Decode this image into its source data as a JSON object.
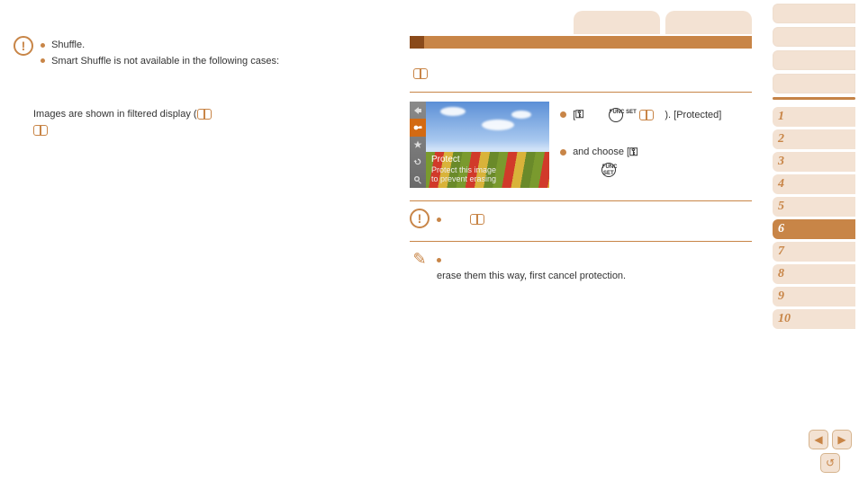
{
  "left": {
    "warn_line1": "Shuffle.",
    "warn_line2": "Smart Shuffle is not available in the following cases:",
    "filtered_line": "Images are shown in filtered display ("
  },
  "right": {
    "camera": {
      "protect_label": "Protect",
      "protect_desc1": "Protect this image",
      "protect_desc2": "to prevent erasing"
    },
    "step_text_seg1": "[",
    "step_text_seg2": "). [Protected]",
    "step_text_seg3": "and choose [",
    "warn_after": "",
    "note_after": "erase them this way, first cancel protection.",
    "func_label": "FUNC SET"
  },
  "sidebar": {
    "nums": [
      "1",
      "2",
      "3",
      "4",
      "5",
      "6",
      "7",
      "8",
      "9",
      "10"
    ],
    "active_index": 5
  },
  "nav": {
    "prev": "◀",
    "next": "▶",
    "back": "↺"
  }
}
